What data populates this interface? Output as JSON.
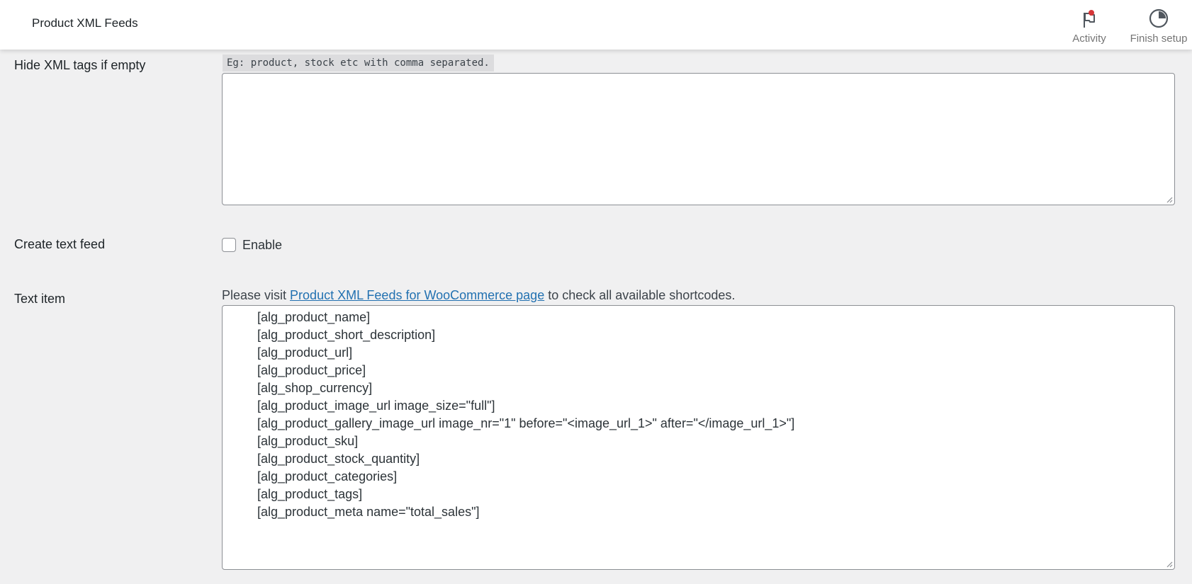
{
  "header": {
    "title": "Product XML Feeds",
    "actions": [
      {
        "label": "Activity",
        "icon": "flag-icon",
        "badge_color": "#d63638"
      },
      {
        "label": "Finish setup",
        "icon": "progress-circle-icon"
      }
    ]
  },
  "hide_tags": {
    "label": "Hide XML tags if empty",
    "hint": "Eg: product, stock etc with comma separated.",
    "value": ""
  },
  "text_feed": {
    "label": "Create text feed",
    "checkbox_label": "Enable",
    "checked": false
  },
  "text_item": {
    "label": "Text item",
    "description_prefix": "Please visit ",
    "description_link": "Product XML Feeds for WooCommerce page",
    "description_suffix": " to check all available shortcodes.",
    "lines": [
      "[alg_product_name]",
      "[alg_product_short_description]",
      "[alg_product_url]",
      "[alg_product_price]",
      "[alg_shop_currency]",
      "[alg_product_image_url image_size=\"full\"]",
      "[alg_product_gallery_image_url image_nr=\"1\" before=\"<image_url_1>\" after=\"</image_url_1>\"]",
      "[alg_product_sku]",
      "[alg_product_stock_quantity]",
      "[alg_product_categories]",
      "[alg_product_tags]",
      "[alg_product_meta name=\"total_sales\"]"
    ]
  },
  "colors": {
    "link": "#2271b1",
    "background": "#f0f0f1",
    "border": "#8c8f94"
  }
}
